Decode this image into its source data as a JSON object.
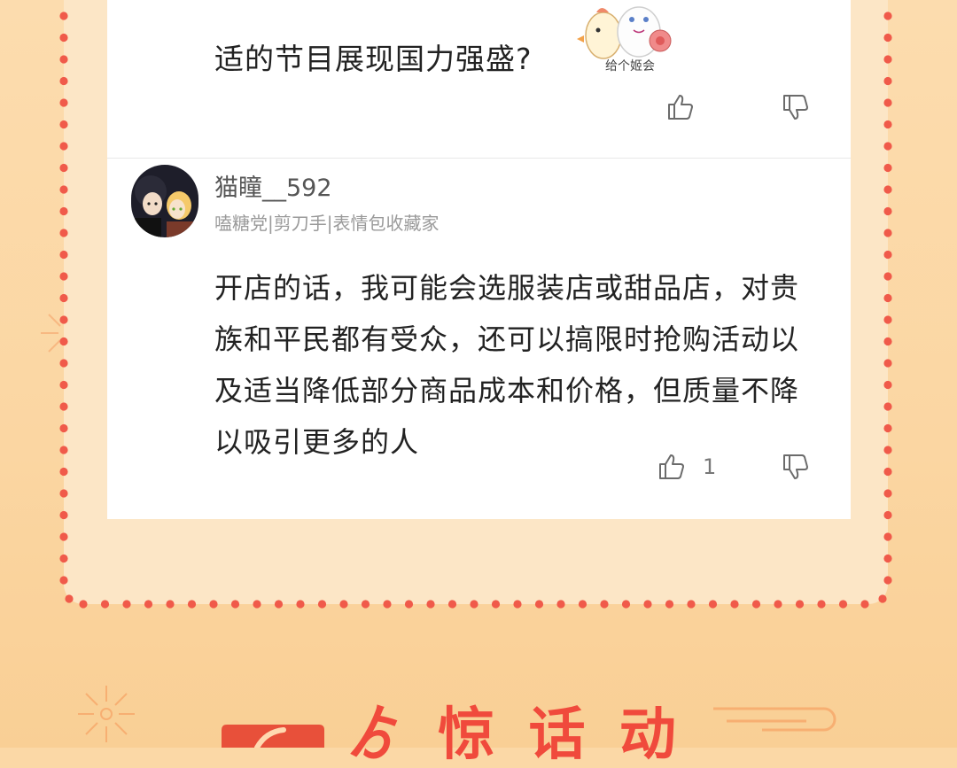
{
  "colors": {
    "background": "#fbd8a6",
    "frame": "#fce6c6",
    "dot_border": "#f05a4a",
    "card": "#ffffff",
    "accent_red": "#f04a3c"
  },
  "comments": [
    {
      "text": "适的节目展现国力强盛?",
      "sticker_caption": "给个姬会",
      "likes": "",
      "like_icon": "thumbs-up-icon",
      "dislike_icon": "thumbs-down-icon"
    },
    {
      "username": "猫瞳__592",
      "tags": "嗑糖党|剪刀手|表情包收藏家",
      "text": "开店的话，我可能会选服装店或甜品店，对贵族和平民都有受众，还可以搞限时抢购活动以及适当降低部分商品成本和价格，但质量不降以吸引更多的人",
      "likes": "1",
      "like_icon": "thumbs-up-icon",
      "dislike_icon": "thumbs-down-icon"
    }
  ],
  "banner": {
    "text": "ゟ 惊 话 动",
    "icon": "logo-badge-icon"
  }
}
